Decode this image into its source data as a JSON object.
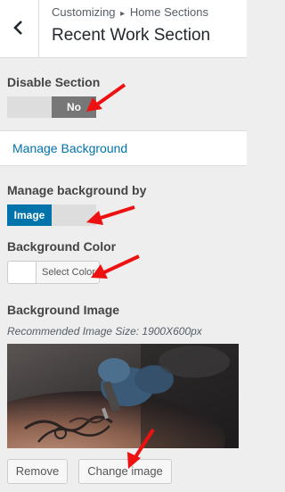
{
  "header": {
    "breadcrumb_parent": "Customizing",
    "breadcrumb_separator": "▸",
    "breadcrumb_section": "Home Sections",
    "title": "Recent Work Section",
    "back_icon": "chevron-left-icon"
  },
  "disable_section": {
    "label": "Disable Section",
    "toggle_value": "No"
  },
  "manage_background_link": "Manage Background",
  "manage_background_by": {
    "label": "Manage background by",
    "toggle_value": "Image"
  },
  "background_color": {
    "label": "Background Color",
    "button_label": "Select Color",
    "current_color": "#ffffff"
  },
  "background_image": {
    "label": "Background Image",
    "hint": "Recommended Image Size: 1900X600px",
    "remove_label": "Remove",
    "change_label": "Change image"
  },
  "colors": {
    "accent": "#0073aa",
    "annotation_arrow": "#ee1111"
  }
}
